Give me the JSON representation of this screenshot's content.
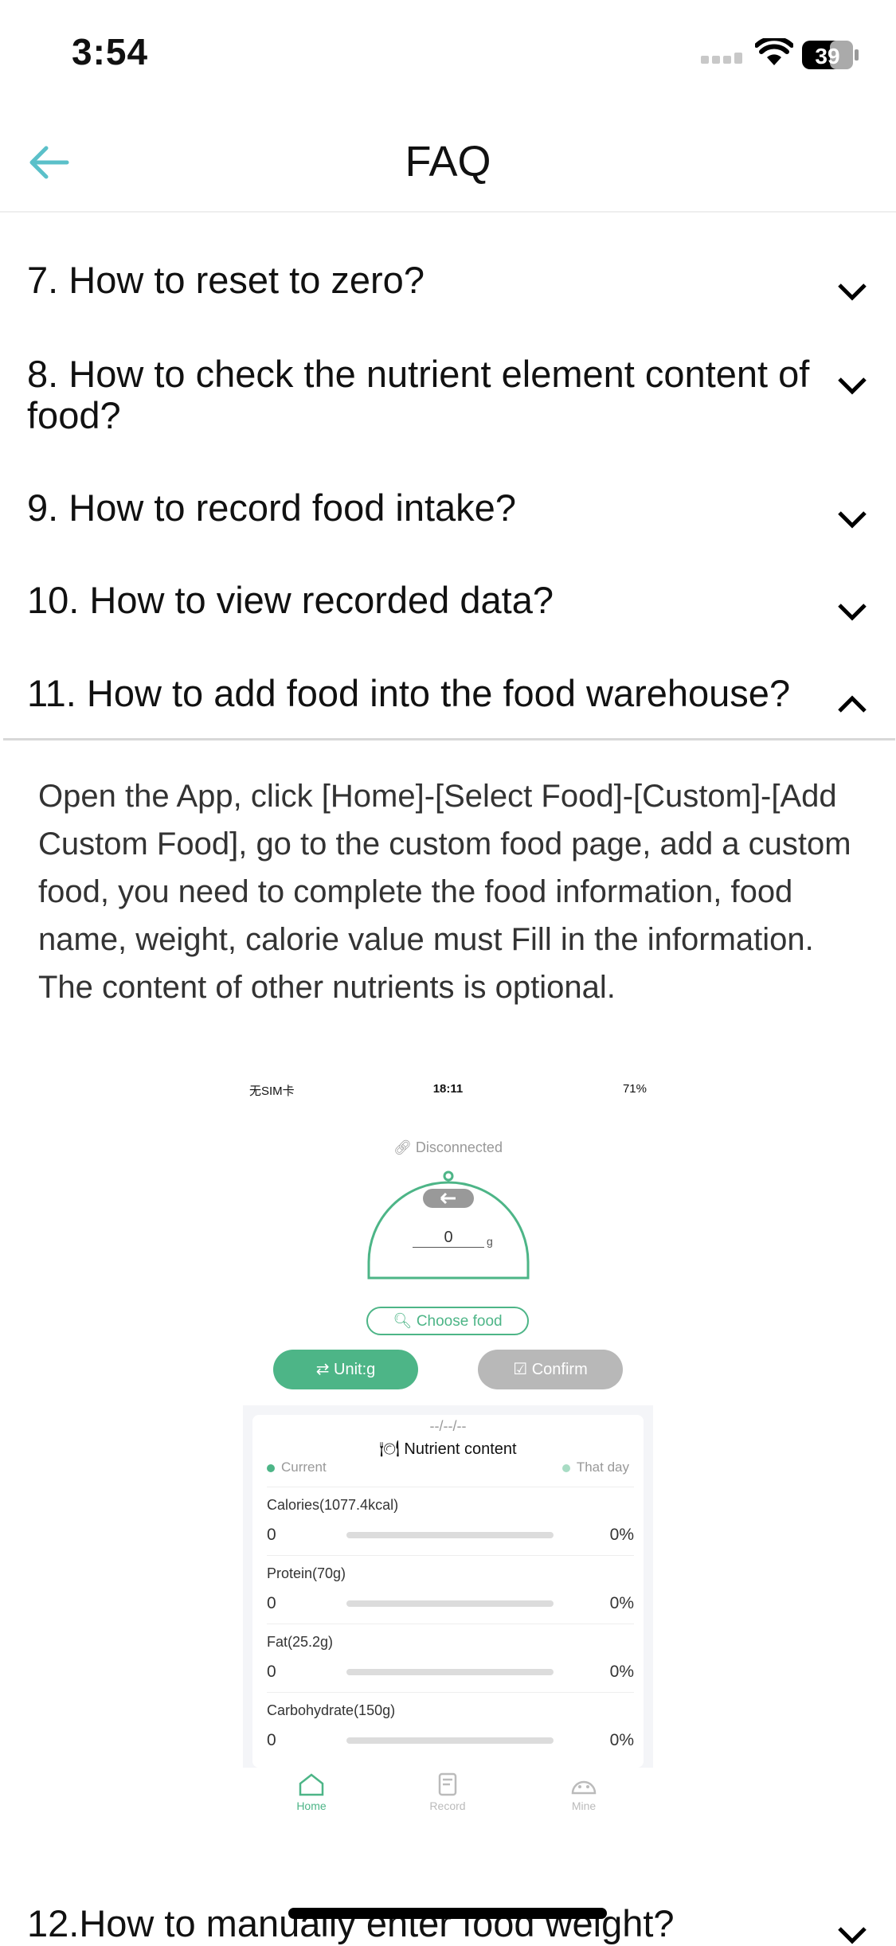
{
  "status_bar": {
    "time": "3:54",
    "battery": "39"
  },
  "nav": {
    "title": "FAQ"
  },
  "faq": [
    {
      "question": "7. How to reset to zero?",
      "expanded": false
    },
    {
      "question": "8. How to check the nutrient element content of food?",
      "expanded": false
    },
    {
      "question": "9. How to record food intake?",
      "expanded": false
    },
    {
      "question": "10. How to view recorded data?",
      "expanded": false
    },
    {
      "question": "11. How to add food into the food warehouse?",
      "expanded": true
    },
    {
      "question": "12.How to manually enter food weight?",
      "expanded": false
    }
  ],
  "answer": "Open the App, click [Home]-[Select Food]-[Custom]-[Add Custom Food], go to the custom food page, add a custom food, you need to complete the food information, food name, weight, calorie value must Fill in the information. The content of other nutrients is optional.",
  "screenshot": {
    "status_left": "无SIM卡",
    "status_time": "18:11",
    "status_battery": "71%",
    "connection": "Disconnected",
    "weight_value": "0",
    "weight_unit": "g",
    "choose_food": "Choose food",
    "unit_button": "Unit:g",
    "confirm_button": "Confirm",
    "date": "--/--/--",
    "nutrient_title": "Nutrient content",
    "legend_current": "Current",
    "legend_day": "That day",
    "nutrients": [
      {
        "label": "Calories(1077.4kcal)",
        "value": "0",
        "percent": "0%"
      },
      {
        "label": "Protein(70g)",
        "value": "0",
        "percent": "0%"
      },
      {
        "label": "Fat(25.2g)",
        "value": "0",
        "percent": "0%"
      },
      {
        "label": "Carbohydrate(150g)",
        "value": "0",
        "percent": "0%"
      }
    ],
    "tabs": [
      {
        "label": "Home",
        "active": true
      },
      {
        "label": "Record",
        "active": false
      },
      {
        "label": "Mine",
        "active": false
      }
    ],
    "colors": {
      "accent": "#4db587",
      "legend_day": "#a8dcc4"
    }
  },
  "colors": {
    "back_arrow": "#5bc0c9"
  }
}
